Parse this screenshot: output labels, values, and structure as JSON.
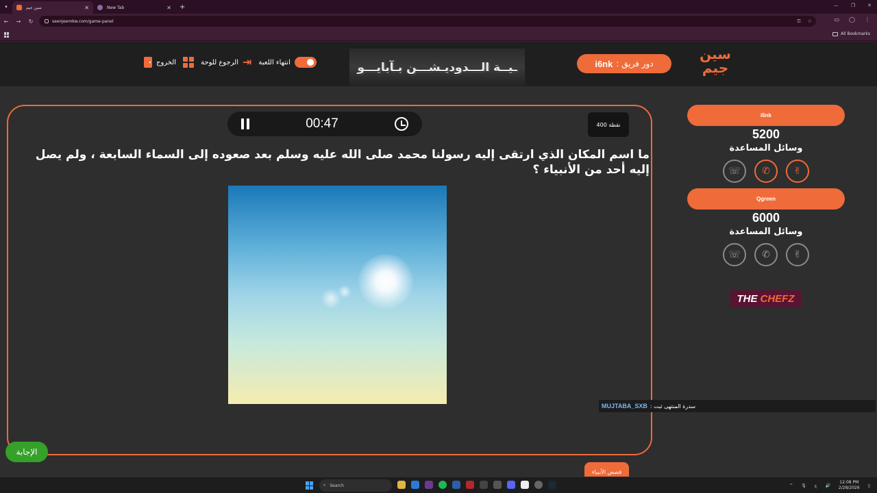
{
  "browser": {
    "tabs": [
      {
        "title": "سين جيم",
        "active": true
      },
      {
        "title": "New Tab",
        "active": false
      }
    ],
    "url": "seenjeemkw.com/game-panel",
    "bookmarks_label": "All Bookmarks"
  },
  "header": {
    "logo_text": "سين جيم",
    "turn_label": "دور فريق :",
    "turn_team": "i6nk",
    "banner_text": "ـيــة الـــدوديـشـــن بـآبايـــو",
    "end_game": "انتهاء اللعبة",
    "back_to_board": "الرجوع للوحة",
    "exit": "الخروج"
  },
  "question": {
    "timer": "00:47",
    "points": "400 نقطة",
    "text": "ما اسم المكان الذي ارتقى إليه رسولنا محمد صلى الله عليه وسلم بعد صعوده إلى السماء السابعة ، ولم يصل إليه أحد من الأنبياء ؟",
    "category": "قصص الأنبياء",
    "answer_button": "الإجابة"
  },
  "teams": [
    {
      "name": "i6nk",
      "score": "5200",
      "aids_label": "وسائل المساعدة",
      "aids": [
        "call-icon",
        "phone-icon",
        "two-answers-icon"
      ],
      "active_aids": [
        false,
        true,
        true
      ]
    },
    {
      "name": "Qgreen",
      "score": "6000",
      "aids_label": "وسائل المساعدة",
      "aids": [
        "call-icon",
        "phone-icon",
        "two-answers-icon"
      ],
      "active_aids": [
        false,
        false,
        false
      ]
    }
  ],
  "sponsor": {
    "part1": "THE",
    "part2": "CHEFZ"
  },
  "ticker": {
    "name": "MUJTABA_SXB",
    "text": ": سدرة المنتهى ثبت"
  },
  "taskbar": {
    "search_placeholder": "Search",
    "time": "12:08 PM",
    "date": "2/28/2026"
  },
  "colors": {
    "accent": "#ef6b3a",
    "answer": "#35a02a"
  }
}
